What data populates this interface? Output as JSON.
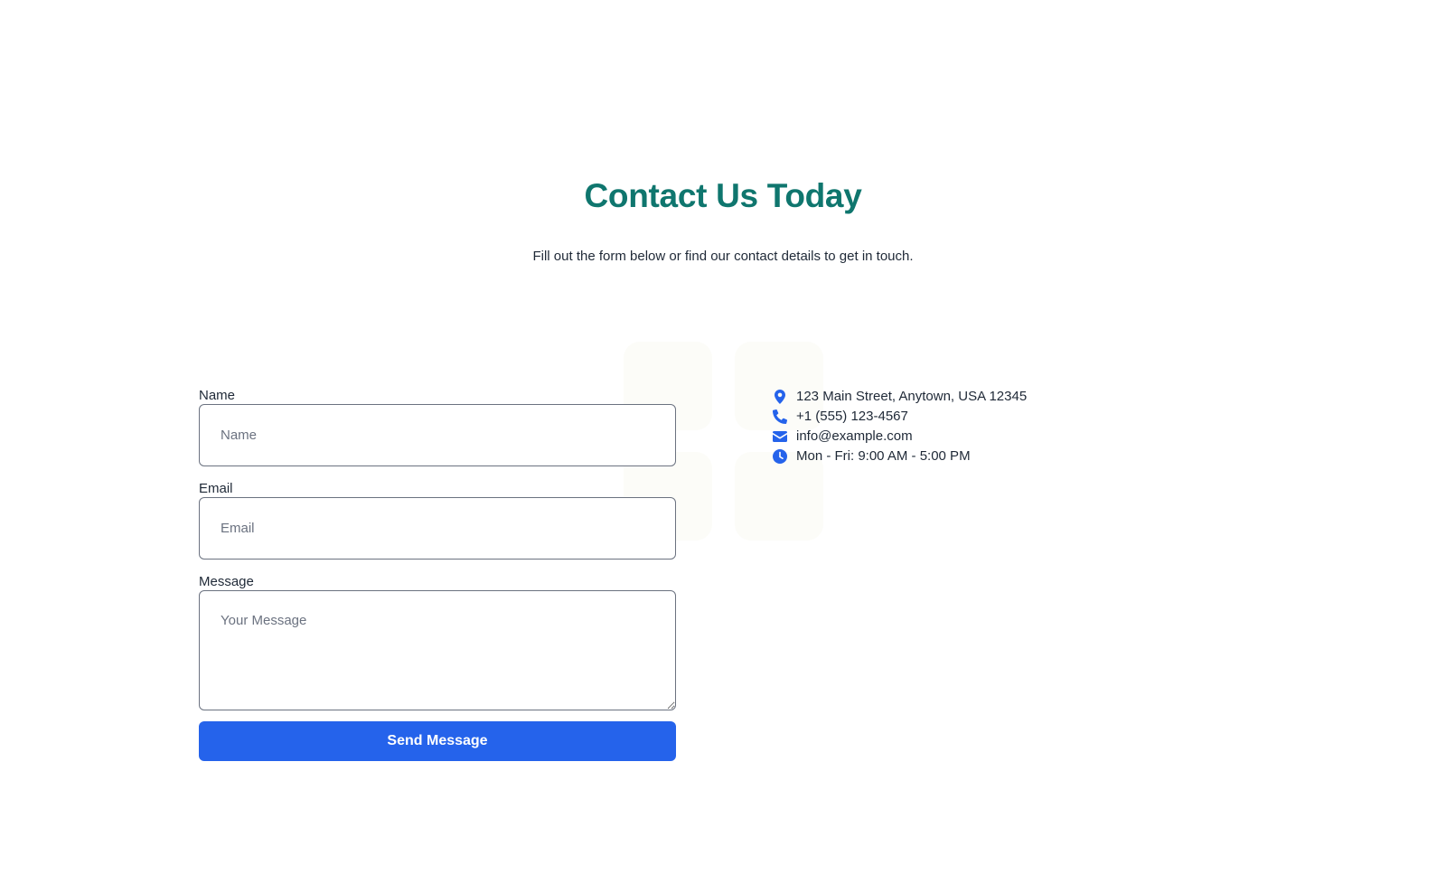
{
  "header": {
    "title": "Contact Us Today",
    "subtitle": "Fill out the form below or find our contact details to get in touch."
  },
  "form": {
    "name": {
      "label": "Name",
      "placeholder": "Name",
      "value": ""
    },
    "email": {
      "label": "Email",
      "placeholder": "Email",
      "value": ""
    },
    "message": {
      "label": "Message",
      "placeholder": "Your Message",
      "value": ""
    },
    "submit_label": "Send Message"
  },
  "contact_info": {
    "address": {
      "icon": "map-pin-icon",
      "text": "123 Main Street, Anytown, USA 12345"
    },
    "phone": {
      "icon": "phone-icon",
      "text": "+1 (555) 123-4567"
    },
    "email": {
      "icon": "envelope-icon",
      "text": "info@example.com"
    },
    "hours": {
      "icon": "clock-icon",
      "text": "Mon - Fri: 9:00 AM - 5:00 PM"
    }
  },
  "colors": {
    "heading": "#0f766e",
    "accent": "#2563eb",
    "text": "#1f2937"
  }
}
